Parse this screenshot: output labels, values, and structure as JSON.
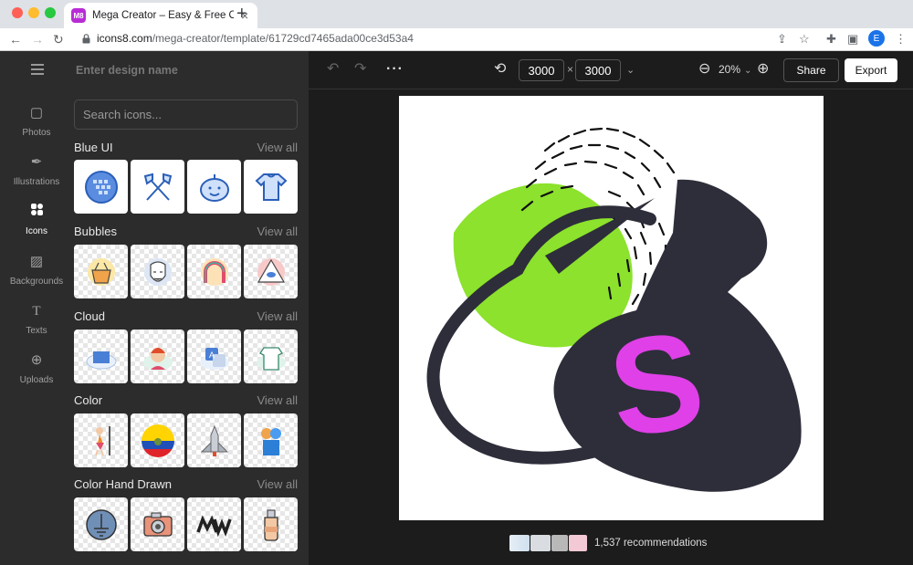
{
  "browser": {
    "tab_title": "Mega Creator – Easy & Free Online Graphic Design",
    "favicon_text": "M8",
    "url_host": "icons8.com",
    "url_path": "/mega-creator/template/61729cd7465ada00ce3d53a4",
    "profile_initial": "E"
  },
  "rail": {
    "items": [
      {
        "label": "Photos",
        "icon": "photo-icon"
      },
      {
        "label": "Illustrations",
        "icon": "pen-nib-icon"
      },
      {
        "label": "Icons",
        "icon": "icons-icon"
      },
      {
        "label": "Backgrounds",
        "icon": "image-icon"
      },
      {
        "label": "Texts",
        "icon": "text-icon"
      },
      {
        "label": "Uploads",
        "icon": "upload-icon"
      }
    ],
    "active": "Icons"
  },
  "panel": {
    "design_name_placeholder": "Enter design name",
    "search_placeholder": "Search icons...",
    "view_all": "View all",
    "sections": [
      {
        "title": "Blue UI",
        "icons": [
          "webmoney-icon",
          "crossed-axes-icon",
          "pumpkin-icon",
          "baby-bodysuit-icon"
        ]
      },
      {
        "title": "Bubbles",
        "icons": [
          "basket-icon",
          "anonymous-mask-icon",
          "arch-icon",
          "eye-pyramid-icon"
        ]
      },
      {
        "title": "Cloud",
        "icons": [
          "cloud-folder-icon",
          "avatar-icon",
          "translate-icon",
          "cloud-shirt-icon"
        ]
      },
      {
        "title": "Color",
        "icons": [
          "dancer-icon",
          "ecuador-flag-icon",
          "spaceship-icon",
          "gift-shapes-icon"
        ]
      },
      {
        "title": "Color Hand Drawn",
        "icons": [
          "ground-circle-icon",
          "camera-icon",
          "mw-logo-icon",
          "bottle-icon"
        ]
      }
    ]
  },
  "toolbar": {
    "width": "3000",
    "height": "3000",
    "times": "×",
    "zoom": "20%",
    "share": "Share",
    "export": "Export"
  },
  "canvas": {
    "letter": "S"
  },
  "recommendations": {
    "text": "1,537 recommendations"
  },
  "colors": {
    "accent_green": "#86e021",
    "accent_magenta": "#e040e8",
    "ink": "#2d2e3a"
  }
}
